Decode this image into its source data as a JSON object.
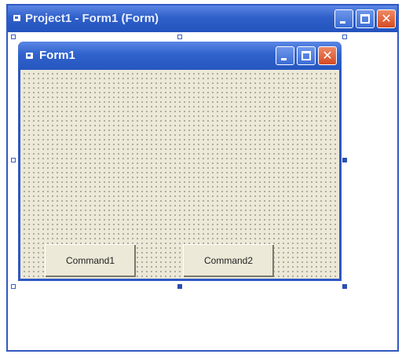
{
  "designer_window": {
    "title": "Project1 - Form1 (Form)",
    "icon": "form-icon",
    "controls": {
      "minimize": "minimize-icon",
      "maximize": "maximize-icon",
      "close": "close-icon"
    }
  },
  "form_window": {
    "title": "Form1",
    "icon": "form-icon",
    "controls": {
      "minimize": "minimize-icon",
      "maximize": "maximize-icon",
      "close": "close-icon"
    },
    "buttons": [
      "Command1",
      "Command2"
    ]
  },
  "colors": {
    "title_bar": "#2f5fc8",
    "close_button": "#d44a22",
    "form_background": "#ece9d8",
    "border": "#3358c2"
  }
}
